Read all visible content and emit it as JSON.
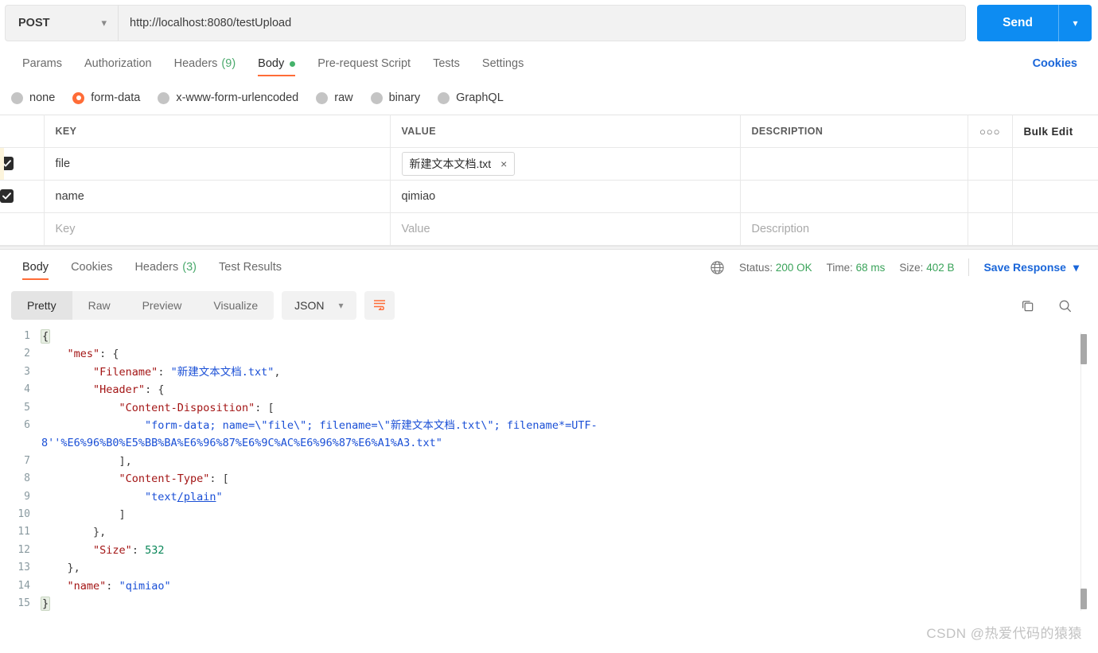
{
  "request": {
    "method": "POST",
    "url": "http://localhost:8080/testUpload",
    "send_label": "Send",
    "tabs": [
      {
        "label": "Params",
        "active": false
      },
      {
        "label": "Authorization",
        "active": false
      },
      {
        "label": "Headers",
        "count": "(9)",
        "active": false
      },
      {
        "label": "Body",
        "active": true,
        "dot": true
      },
      {
        "label": "Pre-request Script",
        "active": false
      },
      {
        "label": "Tests",
        "active": false
      },
      {
        "label": "Settings",
        "active": false
      }
    ],
    "cookies_link": "Cookies",
    "body_types": [
      {
        "label": "none",
        "selected": false
      },
      {
        "label": "form-data",
        "selected": true
      },
      {
        "label": "x-www-form-urlencoded",
        "selected": false
      },
      {
        "label": "raw",
        "selected": false
      },
      {
        "label": "binary",
        "selected": false
      },
      {
        "label": "GraphQL",
        "selected": false
      }
    ],
    "table": {
      "headers": {
        "key": "KEY",
        "value": "VALUE",
        "description": "DESCRIPTION",
        "bulk_edit": "Bulk Edit",
        "more": "ooo"
      },
      "rows": [
        {
          "checked": true,
          "key": "file",
          "value": "新建文本文档.txt",
          "is_file": true,
          "remove": "×",
          "description": ""
        },
        {
          "checked": true,
          "key": "name",
          "value": "qimiao",
          "is_file": false,
          "description": ""
        }
      ],
      "empty_row": {
        "key_placeholder": "Key",
        "value_placeholder": "Value",
        "description_placeholder": "Description"
      }
    }
  },
  "response": {
    "tabs": [
      {
        "label": "Body",
        "active": true
      },
      {
        "label": "Cookies",
        "active": false
      },
      {
        "label": "Headers",
        "count": "(3)",
        "active": false
      },
      {
        "label": "Test Results",
        "active": false
      }
    ],
    "status_label": "Status:",
    "status_value": "200 OK",
    "time_label": "Time:",
    "time_value": "68 ms",
    "size_label": "Size:",
    "size_value": "402 B",
    "save_response": "Save Response",
    "view_modes": [
      {
        "label": "Pretty",
        "active": true
      },
      {
        "label": "Raw",
        "active": false
      },
      {
        "label": "Preview",
        "active": false
      },
      {
        "label": "Visualize",
        "active": false
      }
    ],
    "format": "JSON",
    "icons": {
      "globe": "globe-icon",
      "wrap": "wrap-lines-icon",
      "copy": "copy-icon",
      "search": "search-icon",
      "chevron": "chevron-down-icon"
    },
    "code": {
      "lines": [
        {
          "n": "1",
          "tokens": [
            {
              "t": "{",
              "c": "brace-hl"
            }
          ]
        },
        {
          "n": "2",
          "tokens": [
            {
              "t": "    ",
              "c": "p"
            },
            {
              "t": "\"mes\"",
              "c": "k"
            },
            {
              "t": ": {",
              "c": "p"
            }
          ]
        },
        {
          "n": "3",
          "tokens": [
            {
              "t": "        ",
              "c": "p"
            },
            {
              "t": "\"Filename\"",
              "c": "k"
            },
            {
              "t": ": ",
              "c": "p"
            },
            {
              "t": "\"新建文本文档.txt\"",
              "c": "s"
            },
            {
              "t": ",",
              "c": "p"
            }
          ]
        },
        {
          "n": "4",
          "tokens": [
            {
              "t": "        ",
              "c": "p"
            },
            {
              "t": "\"Header\"",
              "c": "k"
            },
            {
              "t": ": {",
              "c": "p"
            }
          ]
        },
        {
          "n": "5",
          "tokens": [
            {
              "t": "            ",
              "c": "p"
            },
            {
              "t": "\"Content-Disposition\"",
              "c": "k"
            },
            {
              "t": ": [",
              "c": "p"
            }
          ]
        },
        {
          "n": "6",
          "wrap": true,
          "tokens": [
            {
              "t": "                ",
              "c": "p"
            },
            {
              "t": "\"form-data; name=\\\"file\\\"; filename=\\\"新建文本文档.txt\\\"; filename*=UTF-8''%E6%96%B0%E5%BB%BA%E6%96%87%E6%9C%AC%E6%96%87%E6%A1%A3.txt\"",
              "c": "s"
            }
          ]
        },
        {
          "n": "7",
          "tokens": [
            {
              "t": "            ],",
              "c": "p"
            }
          ]
        },
        {
          "n": "8",
          "tokens": [
            {
              "t": "            ",
              "c": "p"
            },
            {
              "t": "\"Content-Type\"",
              "c": "k"
            },
            {
              "t": ": [",
              "c": "p"
            }
          ]
        },
        {
          "n": "9",
          "tokens": [
            {
              "t": "                ",
              "c": "p"
            },
            {
              "t": "\"text",
              "c": "s"
            },
            {
              "t": "/plain",
              "c": "s u"
            },
            {
              "t": "\"",
              "c": "s"
            }
          ]
        },
        {
          "n": "10",
          "tokens": [
            {
              "t": "            ]",
              "c": "p"
            }
          ]
        },
        {
          "n": "11",
          "tokens": [
            {
              "t": "        },",
              "c": "p"
            }
          ]
        },
        {
          "n": "12",
          "tokens": [
            {
              "t": "        ",
              "c": "p"
            },
            {
              "t": "\"Size\"",
              "c": "k"
            },
            {
              "t": ": ",
              "c": "p"
            },
            {
              "t": "532",
              "c": "n"
            }
          ]
        },
        {
          "n": "13",
          "tokens": [
            {
              "t": "    },",
              "c": "p"
            }
          ]
        },
        {
          "n": "14",
          "tokens": [
            {
              "t": "    ",
              "c": "p"
            },
            {
              "t": "\"name\"",
              "c": "k"
            },
            {
              "t": ": ",
              "c": "p"
            },
            {
              "t": "\"qimiao\"",
              "c": "s"
            }
          ]
        },
        {
          "n": "15",
          "tokens": [
            {
              "t": "}",
              "c": "brace-hl"
            }
          ]
        }
      ]
    }
  },
  "watermark": "CSDN @热爱代码的猿猿",
  "colors": {
    "accent_orange": "#ff6c37",
    "send_blue": "#0d8cf2",
    "link_blue": "#1a66d9",
    "status_green": "#3aa35a"
  }
}
